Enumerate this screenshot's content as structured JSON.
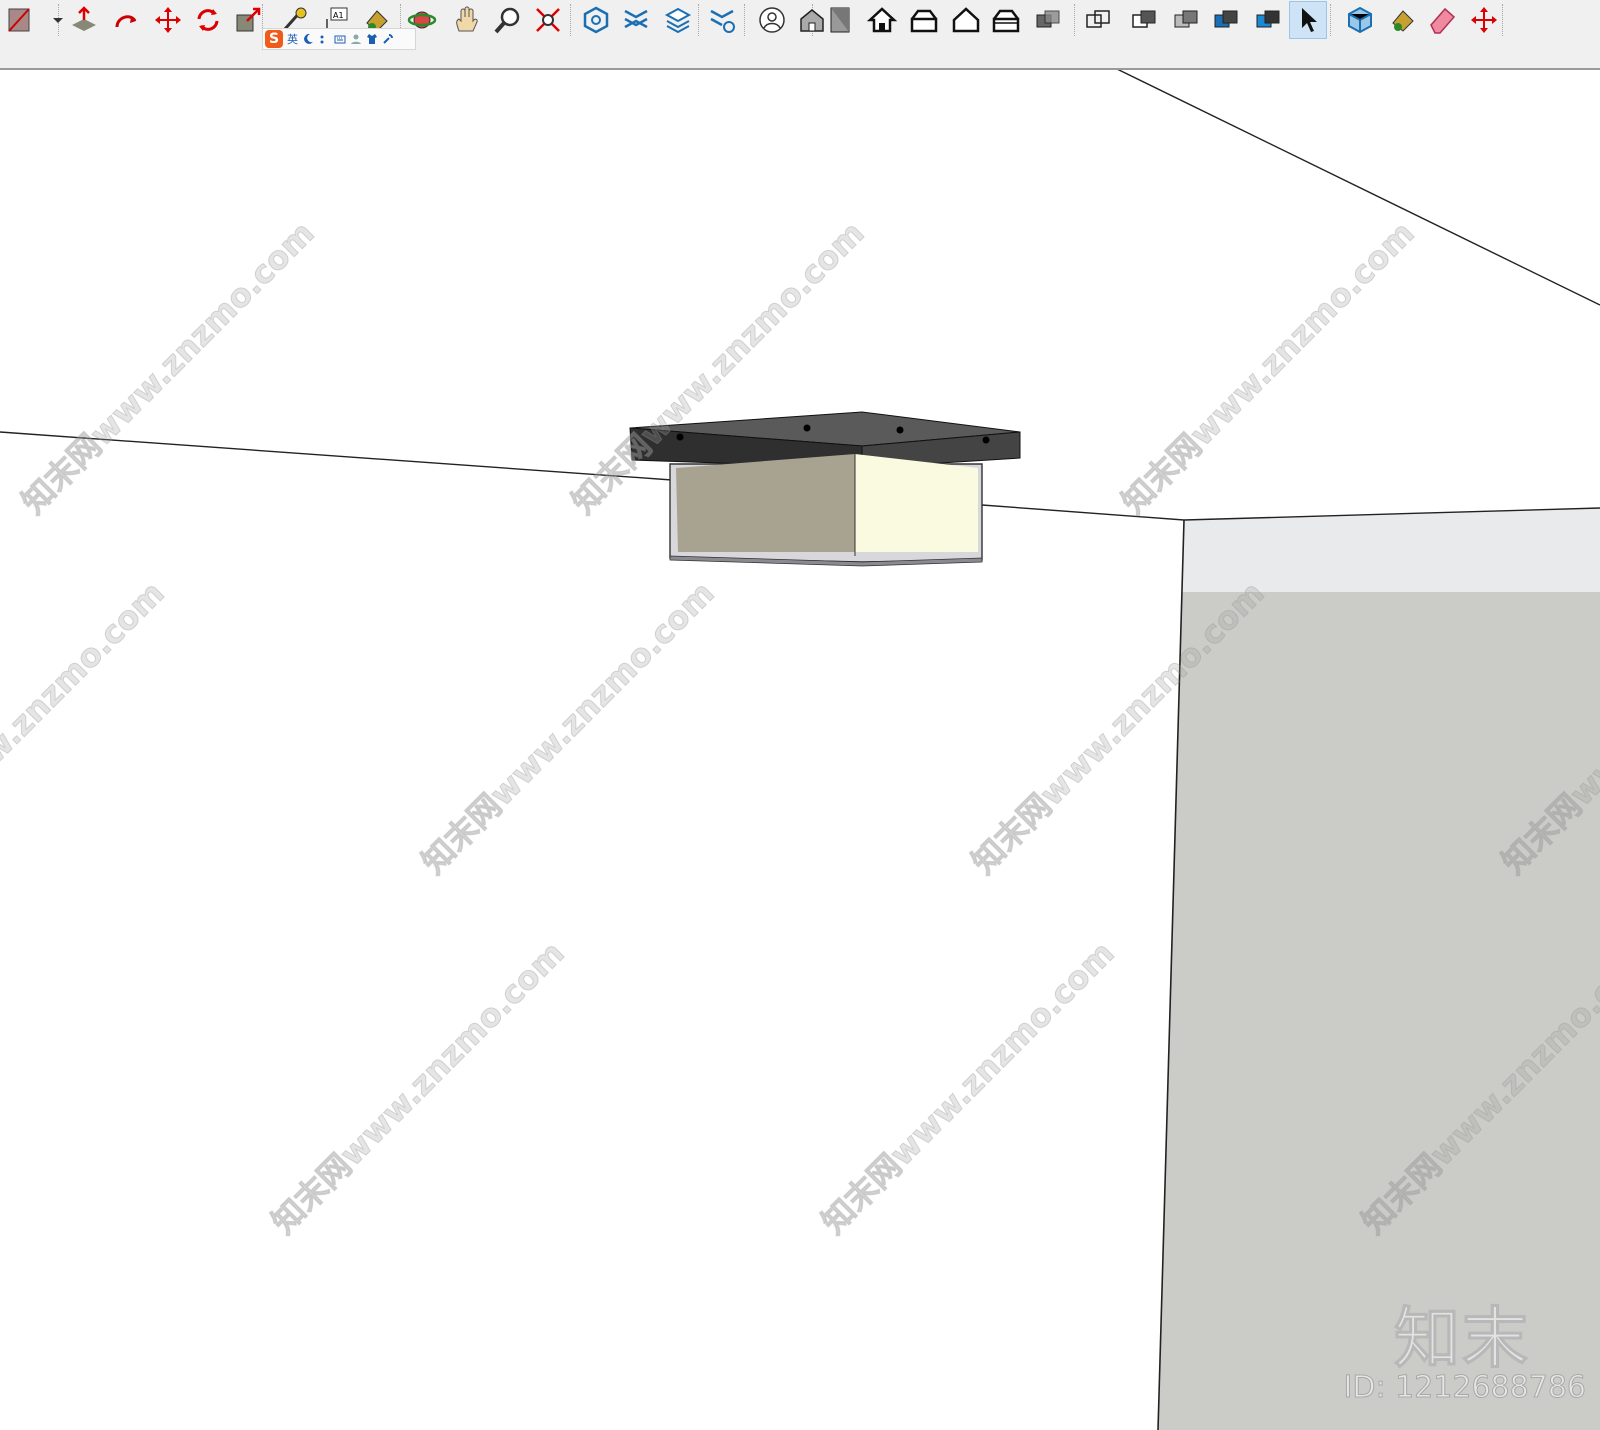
{
  "toolbar": {
    "tools": [
      {
        "name": "paint-icon"
      },
      {
        "name": "dropdown-arrow-icon"
      },
      {
        "name": "push-pull-icon"
      },
      {
        "name": "follow-me-icon"
      },
      {
        "name": "move-icon"
      },
      {
        "name": "rotate-icon"
      },
      {
        "name": "scale-icon"
      },
      {
        "name": "tape-measure-icon"
      },
      {
        "name": "text-tool-icon",
        "label": "A1"
      },
      {
        "name": "paint-bucket-icon"
      },
      {
        "name": "orbit-icon"
      },
      {
        "name": "pan-icon"
      },
      {
        "name": "zoom-icon"
      },
      {
        "name": "zoom-extents-icon"
      },
      {
        "name": "section-plane-icon"
      },
      {
        "name": "section-fill-icon"
      },
      {
        "name": "section-cuts-icon"
      },
      {
        "name": "section-settings-icon"
      },
      {
        "name": "account-icon"
      },
      {
        "name": "iso-view-icon"
      },
      {
        "name": "top-view-icon"
      },
      {
        "name": "front-view-icon"
      },
      {
        "name": "right-view-icon"
      },
      {
        "name": "back-view-icon"
      },
      {
        "name": "left-view-icon"
      },
      {
        "name": "style-xray-icon"
      },
      {
        "name": "style-wireframe-icon"
      },
      {
        "name": "style-hidden-line-icon"
      },
      {
        "name": "style-shaded-icon"
      },
      {
        "name": "style-shaded-textures-icon"
      },
      {
        "name": "style-monochrome-icon"
      },
      {
        "name": "select-icon"
      },
      {
        "name": "components-icon"
      },
      {
        "name": "paint-bucket-icon-2"
      },
      {
        "name": "eraser-icon"
      },
      {
        "name": "move-icon-2"
      }
    ]
  },
  "ime": {
    "logo": "S",
    "mode": "英"
  },
  "scene": {
    "wall_color": "#ffffff",
    "cabinet_color": "#cbcbc7",
    "cabinet_top_color": "#e9eaeb",
    "lamp_cap_color": "#3a3a3a",
    "lamp_shade_left": "#a8a290",
    "lamp_shade_right": "#fafae0"
  },
  "watermark": {
    "text": "知末网www.znzmo.com",
    "brand": "知末",
    "id_text": "ID: 1212688786"
  }
}
